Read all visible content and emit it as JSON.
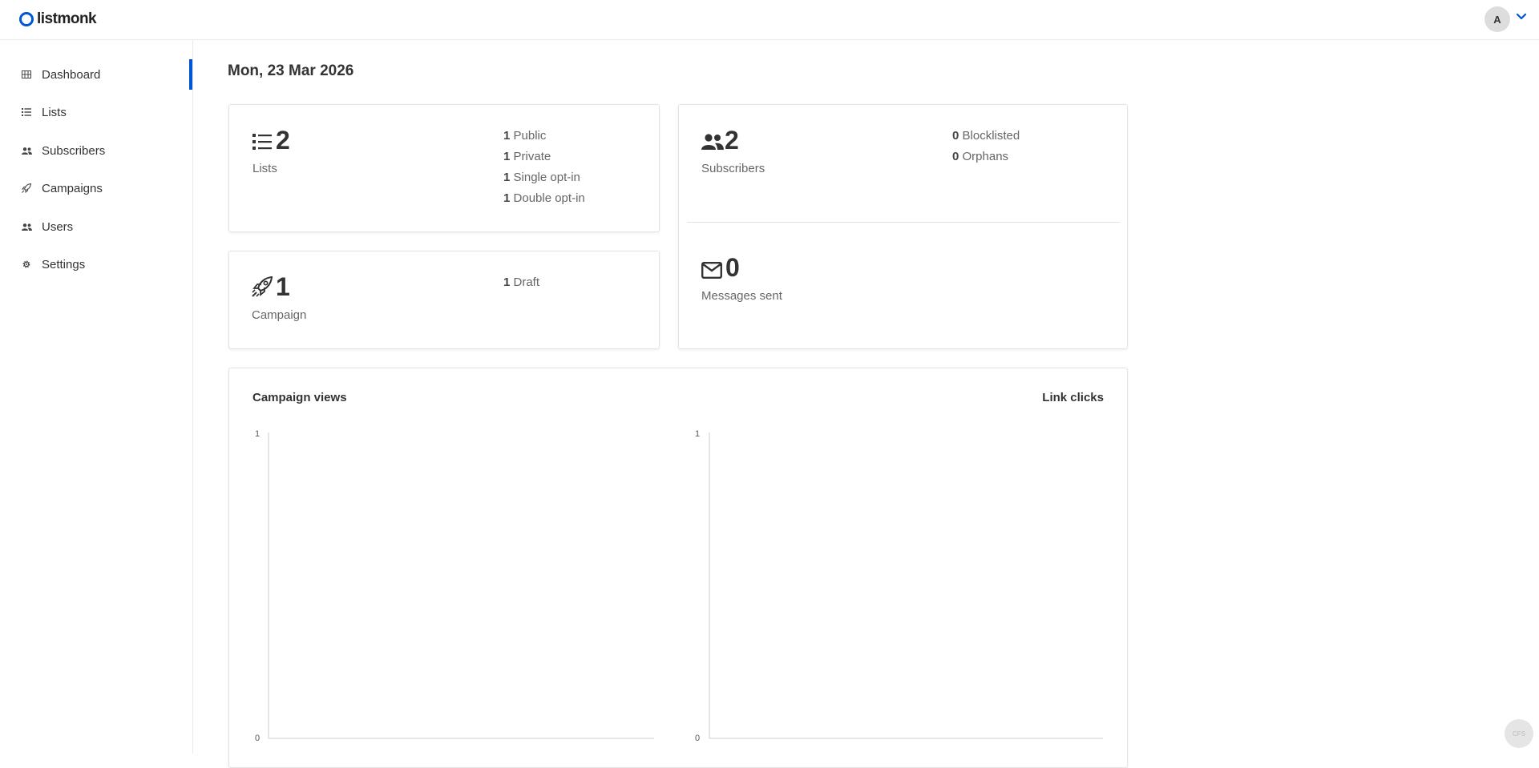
{
  "app": {
    "name": "listmonk"
  },
  "header": {
    "avatar_initial": "A"
  },
  "sidebar": {
    "items": [
      {
        "label": "Dashboard",
        "icon": "dashboard-icon",
        "active": true
      },
      {
        "label": "Lists",
        "icon": "list-icon"
      },
      {
        "label": "Subscribers",
        "icon": "subscribers-icon"
      },
      {
        "label": "Campaigns",
        "icon": "rocket-icon"
      },
      {
        "label": "Users",
        "icon": "users-icon"
      },
      {
        "label": "Settings",
        "icon": "gear-icon"
      }
    ]
  },
  "dashboard": {
    "date": "Mon, 23 Mar 2026",
    "lists": {
      "count": "2",
      "label": "Lists",
      "details": [
        {
          "value": "1",
          "label": "Public"
        },
        {
          "value": "1",
          "label": "Private"
        },
        {
          "value": "1",
          "label": "Single opt-in"
        },
        {
          "value": "1",
          "label": "Double opt-in"
        }
      ]
    },
    "subscribers": {
      "count": "2",
      "label": "Subscribers",
      "details": [
        {
          "value": "0",
          "label": "Blocklisted"
        },
        {
          "value": "0",
          "label": "Orphans"
        }
      ]
    },
    "campaigns": {
      "count": "1",
      "label": "Campaign",
      "details": [
        {
          "value": "1",
          "label": "Draft"
        }
      ]
    },
    "messages": {
      "count": "0",
      "label": "Messages sent"
    },
    "charts": {
      "views_title": "Campaign views",
      "clicks_title": "Link clicks"
    }
  },
  "chart_data": [
    {
      "type": "line",
      "title": "Campaign views",
      "x": [],
      "series": [],
      "ylim": [
        0,
        1
      ],
      "yticks": [
        "1",
        "0"
      ]
    },
    {
      "type": "line",
      "title": "Link clicks",
      "x": [],
      "series": [],
      "ylim": [
        0,
        1
      ],
      "yticks": [
        "1",
        "0"
      ]
    }
  ],
  "colors": {
    "accent": "#0055d4",
    "border": "#e4e4e4"
  },
  "corner_badge": "CFS"
}
